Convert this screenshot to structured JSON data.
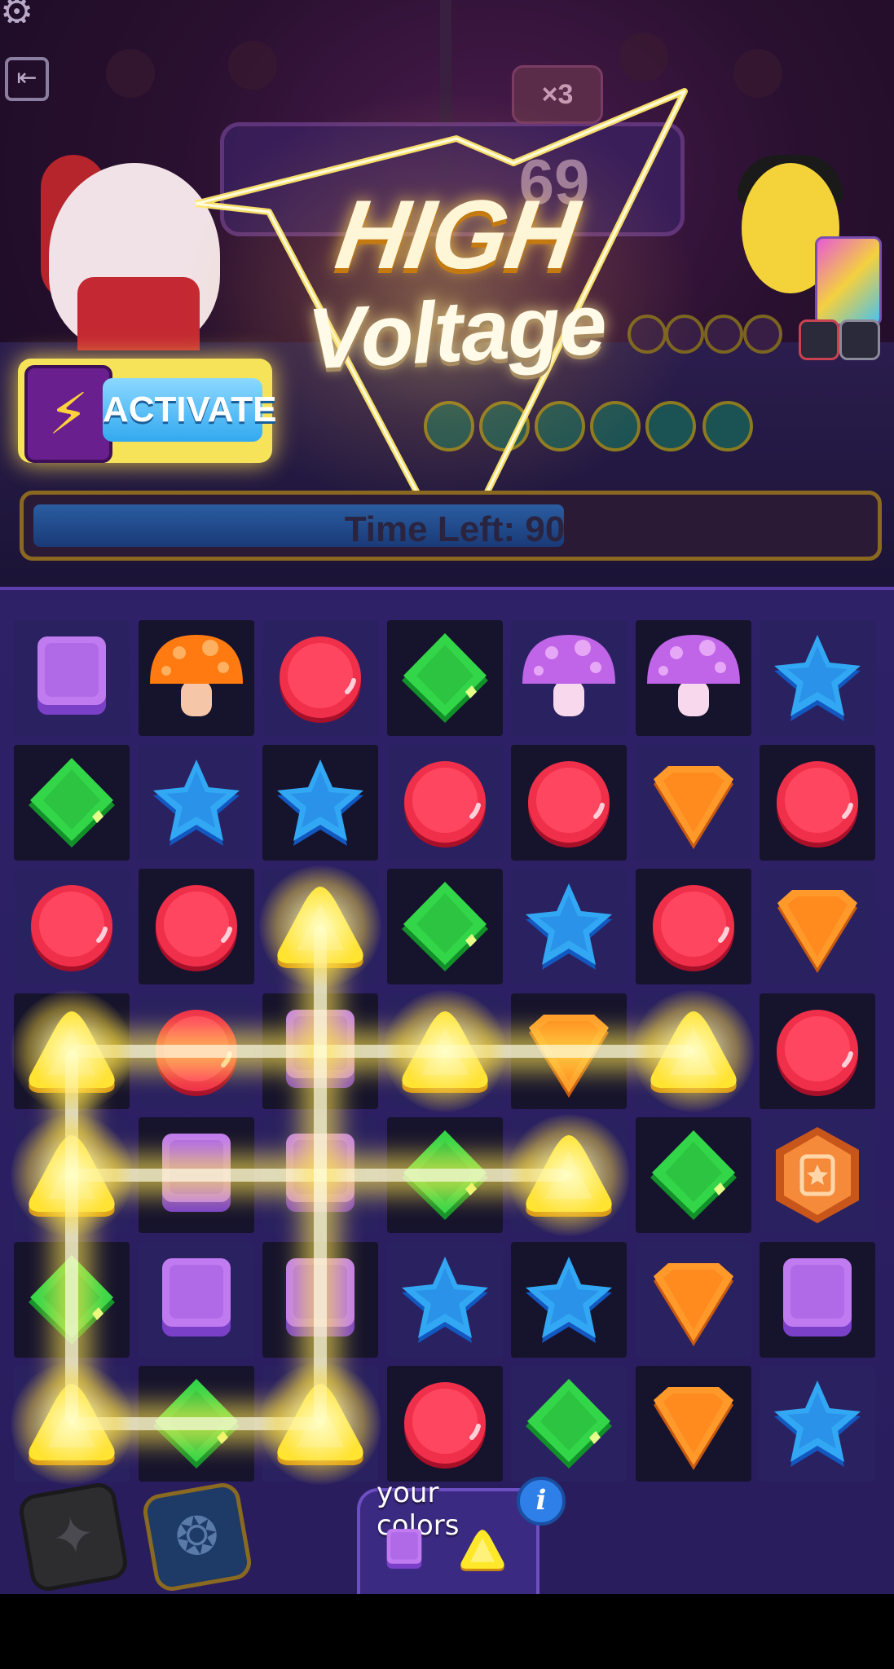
{
  "hud": {
    "settings_icon": "gear-icon",
    "exit_icon": "exit-icon",
    "multiplier": "×3",
    "score": "69"
  },
  "banner": {
    "line1": "HIGH",
    "line2": "Voltage"
  },
  "activate": {
    "label": "ACTIVATE",
    "icon": "lightning-icon"
  },
  "timer": {
    "text": "Time Left: 90",
    "fraction_remaining": 0.63
  },
  "board": {
    "rows": 7,
    "cols": 7,
    "grid": [
      [
        "square-purple",
        "mushroom-orange",
        "circle-red",
        "diamond-green",
        "mushroom-purple",
        "mushroom-purple",
        "star-blue"
      ],
      [
        "diamond-green",
        "star-blue",
        "star-blue",
        "circle-red",
        "circle-red",
        "shield-orange",
        "circle-red"
      ],
      [
        "circle-red",
        "circle-red",
        "triangle-yellow",
        "diamond-green",
        "star-blue",
        "circle-red",
        "shield-orange"
      ],
      [
        "triangle-yellow",
        "circle-red",
        "square-purple",
        "triangle-yellow",
        "shield-orange",
        "triangle-yellow",
        "circle-red"
      ],
      [
        "triangle-yellow",
        "square-purple",
        "square-purple",
        "diamond-green",
        "triangle-yellow",
        "diamond-green",
        "bonus-hex-orange"
      ],
      [
        "diamond-green",
        "square-purple",
        "square-purple",
        "star-blue",
        "star-blue",
        "shield-orange",
        "square-purple"
      ],
      [
        "triangle-yellow",
        "diamond-green",
        "triangle-yellow",
        "circle-red",
        "diamond-green",
        "shield-orange",
        "star-blue"
      ]
    ]
  },
  "boosters": [
    {
      "name": "star-booster",
      "icon": "stars-icon"
    },
    {
      "name": "scarab-booster",
      "icon": "scarab-icon"
    }
  ],
  "your_colors": {
    "label": "your colors",
    "info_icon": "info-icon",
    "info_glyph": "i",
    "colors": [
      "square-purple",
      "triangle-yellow"
    ]
  },
  "colors": {
    "accent_gold": "#f7e35a",
    "board_bg": "#2a1d5e",
    "cell_dark": "#16132c",
    "cell_light": "#3a2d72"
  }
}
